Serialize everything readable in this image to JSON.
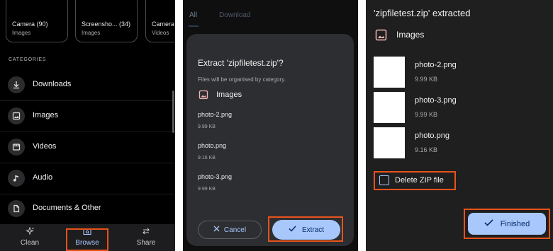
{
  "panel1": {
    "folders": [
      {
        "name": "Camera (90)",
        "type": "Images"
      },
      {
        "name": "Screensho... (34)",
        "type": "Images"
      },
      {
        "name": "Camera",
        "type": "Videos"
      }
    ],
    "categories_heading": "CATEGORIES",
    "categories": [
      {
        "label": "Downloads",
        "icon": "download-icon"
      },
      {
        "label": "Images",
        "icon": "image-icon"
      },
      {
        "label": "Videos",
        "icon": "video-icon"
      },
      {
        "label": "Audio",
        "icon": "audio-icon"
      },
      {
        "label": "Documents & Other",
        "icon": "document-icon"
      }
    ],
    "nav": [
      {
        "label": "Clean",
        "icon": "sparkle-icon"
      },
      {
        "label": "Browse",
        "icon": "browse-icon",
        "active": true
      },
      {
        "label": "Share",
        "icon": "swap-arrows-icon"
      }
    ]
  },
  "panel2": {
    "tabs": [
      "All",
      "Download"
    ],
    "dialog": {
      "title": "Extract 'zipfiletest.zip'?",
      "subtitle": "Files will be organised by category.",
      "section": "Images",
      "files": [
        {
          "name": "photo-2.png",
          "size": "9.99 KB"
        },
        {
          "name": "photo.png",
          "size": "9.16 KB"
        },
        {
          "name": "photo-3.png",
          "size": "9.99 KB"
        }
      ],
      "cancel_label": "Cancel",
      "extract_label": "Extract"
    }
  },
  "panel3": {
    "title": "'zipfiletest.zip' extracted",
    "section": "Images",
    "files": [
      {
        "name": "photo-2.png",
        "size": "9.99 KB"
      },
      {
        "name": "photo-3.png",
        "size": "9.99 KB"
      },
      {
        "name": "photo.png",
        "size": "9.16 KB"
      }
    ],
    "delete_label": "Delete ZIP file",
    "delete_checked": false,
    "finish_label": "Finished"
  },
  "colors": {
    "accent": "#a8c7fa",
    "accent_text": "#062e6f",
    "highlight": "#e8521b"
  }
}
